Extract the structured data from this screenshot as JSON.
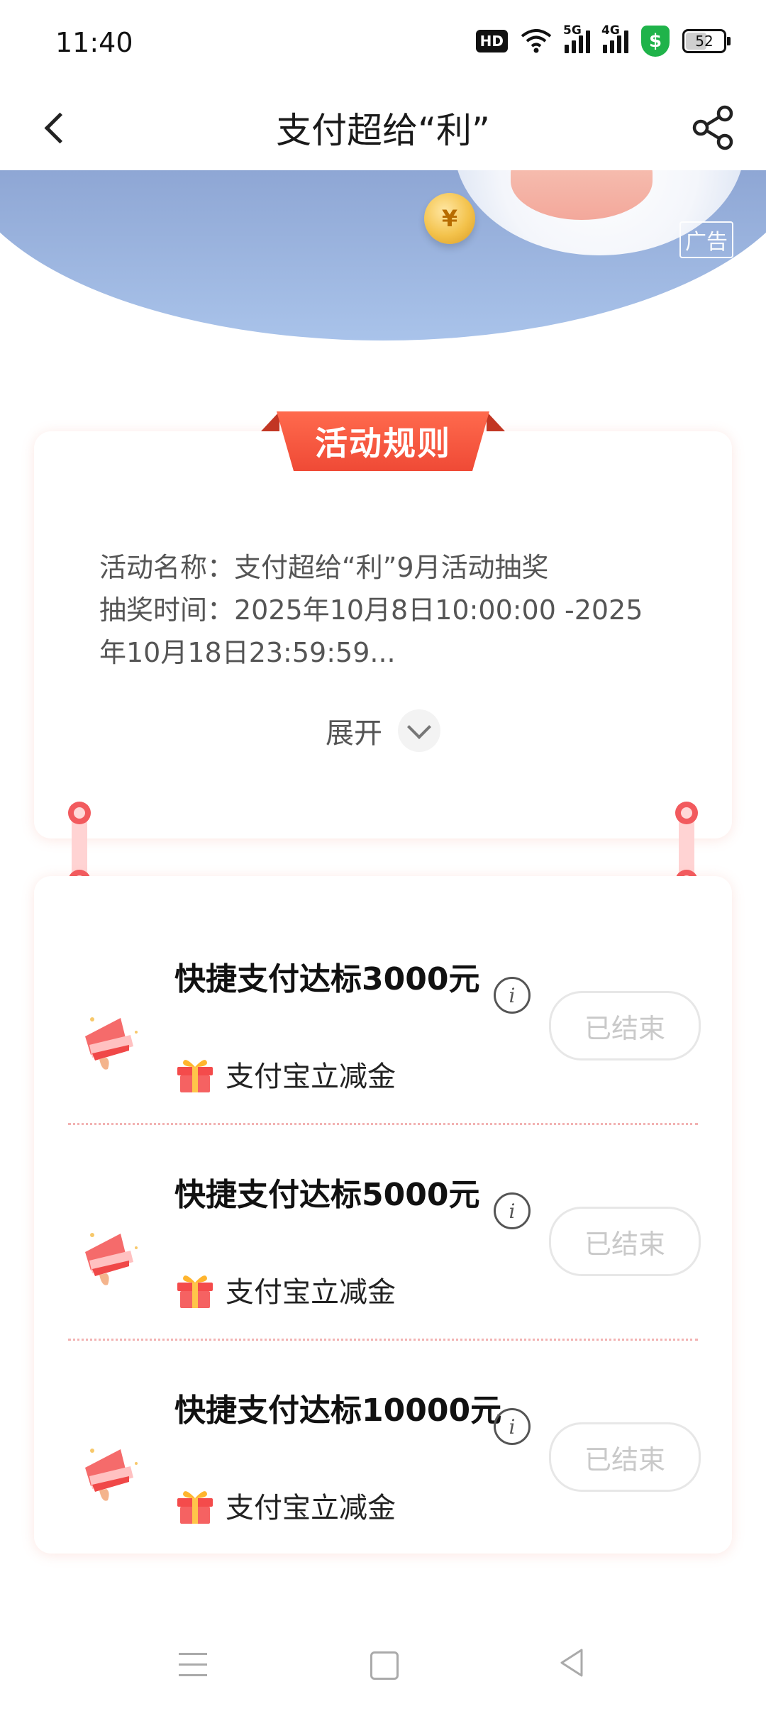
{
  "status_bar": {
    "time": "11:40",
    "hd_badge": "HD",
    "signal_5g": "5G",
    "signal_4g": "4G",
    "shield_symbol": "$",
    "battery_level": "52",
    "battery_fraction": 0.52
  },
  "navbar": {
    "title": "支付超给“利”",
    "back_icon": "chevron-left-icon",
    "share_icon": "share-icon"
  },
  "banner": {
    "coin_symbol": "¥",
    "ad_label": "广告"
  },
  "rules": {
    "ribbon_title": "活动规则",
    "activity_name": "活动名称：支付超给“利”9月活动抽奖",
    "draw_time": "抽奖时间：2025年10月8日10:00:00 -2025年10月18日23:59:59...",
    "expand_label": "展开"
  },
  "tasks": [
    {
      "title": "快捷支付达标3000元",
      "reward": "支付宝立减金",
      "status": "已结束"
    },
    {
      "title": "快捷支付达标5000元",
      "reward": "支付宝立减金",
      "status": "已结束"
    },
    {
      "title": "快捷支付达标10000元",
      "reward": "支付宝立减金",
      "status": "已结束"
    }
  ],
  "info_glyph": "i",
  "colors": {
    "accent_red": "#ef4a36",
    "connector_pink": "#ffd3d3",
    "disabled_text": "#c9c9c9",
    "banner_blue": "#8ea6d4"
  }
}
